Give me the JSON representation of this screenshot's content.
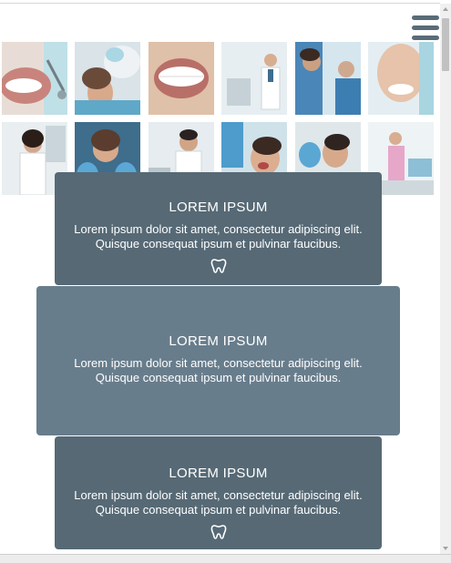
{
  "menu": {
    "icon": "hamburger-menu-icon"
  },
  "gallery": {
    "row1": [
      {
        "name": "smile-closeup-photo"
      },
      {
        "name": "dental-exam-photo"
      },
      {
        "name": "white-teeth-photo"
      },
      {
        "name": "dentist-in-clinic-photo"
      },
      {
        "name": "dentist-explaining-xray-photo"
      },
      {
        "name": "woman-smiling-photo"
      }
    ],
    "row2": [
      {
        "name": "female-dentist-photo"
      },
      {
        "name": "dentist-gloves-photo"
      },
      {
        "name": "male-dentist-photo"
      },
      {
        "name": "patient-treatment-photo"
      },
      {
        "name": "patient-checkup-photo"
      },
      {
        "name": "dental-office-photo"
      }
    ]
  },
  "cards": [
    {
      "title": "LOREM IPSUM",
      "text": "Lorem ipsum dolor sit amet, consectetur adipiscing elit. Quisque consequat ipsum et pulvinar faucibus.",
      "icon": "tooth-icon"
    },
    {
      "title": "LOREM IPSUM",
      "text": "Lorem ipsum dolor sit amet, consectetur adipiscing elit. Quisque consequat ipsum et pulvinar faucibus.",
      "icon": ""
    },
    {
      "title": "LOREM IPSUM",
      "text": "Lorem ipsum dolor sit amet, consectetur adipiscing elit. Quisque consequat ipsum et pulvinar faucibus.",
      "icon": "tooth-icon"
    }
  ],
  "colors": {
    "card_dark": "#566975",
    "card_light": "#687d8c",
    "menu_icon": "#5a6b78"
  }
}
